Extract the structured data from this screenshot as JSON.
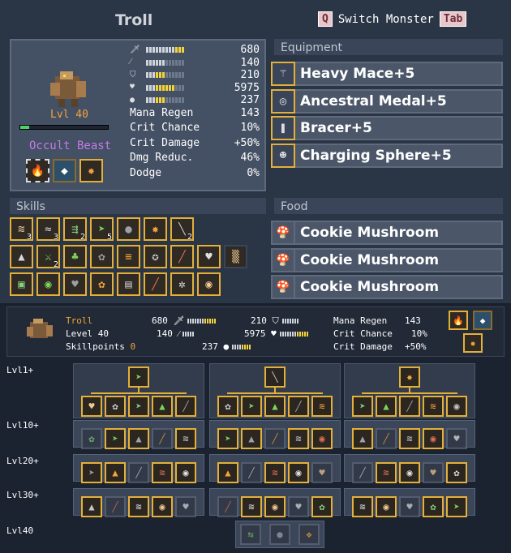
{
  "header": {
    "title": "Troll",
    "switch_key": "Q",
    "switch_label": "Switch Monster",
    "tab_key": "Tab"
  },
  "monster": {
    "level_label": "Lvl 40",
    "type": "Occult Beast",
    "hp_fraction": 0.1,
    "stats_bars": [
      {
        "icon": "sword-icon",
        "value": "680"
      },
      {
        "icon": "staff-icon",
        "value": "140"
      },
      {
        "icon": "shield-icon",
        "value": "210"
      },
      {
        "icon": "heart-icon",
        "value": "5975"
      },
      {
        "icon": "speed-icon",
        "value": "237"
      }
    ],
    "stats_text": [
      {
        "label": "Mana Regen",
        "value": "143"
      },
      {
        "label": "Crit Chance",
        "value": "10%"
      },
      {
        "label": "Crit Damage",
        "value": "+50%"
      },
      {
        "label": "Dmg Reduc.",
        "value": "46%"
      },
      {
        "label": "Dodge",
        "value": "0%"
      }
    ]
  },
  "equipment": {
    "header": "Equipment",
    "items": [
      "Heavy Mace+5",
      "Ancestral Medal+5",
      "Bracer+5",
      "Charging Sphere+5"
    ]
  },
  "skills": {
    "header": "Skills"
  },
  "food": {
    "header": "Food",
    "items": [
      "Cookie Mushroom",
      "Cookie Mushroom",
      "Cookie Mushroom"
    ]
  },
  "info": {
    "name": "Troll",
    "level": "Level 40",
    "skillpoints_label": "Skillpoints",
    "skillpoints": "0",
    "atk": "680",
    "def": "210",
    "mag": "140",
    "hp": "5975",
    "spd": "237",
    "mana_regen_label": "Mana Regen",
    "mana_regen": "143",
    "crit_chance_label": "Crit Chance",
    "crit_chance": "10%",
    "crit_damage_label": "Crit Damage",
    "crit_damage": "+50%"
  },
  "tree_levels": [
    "Lvl1+",
    "Lvl10+",
    "Lvl20+",
    "Lvl30+",
    "Lvl40"
  ],
  "colors": {
    "gold": "#e4b03a",
    "orange": "#f3a33a",
    "purple": "#c47ae8",
    "green": "#4fce6a"
  }
}
